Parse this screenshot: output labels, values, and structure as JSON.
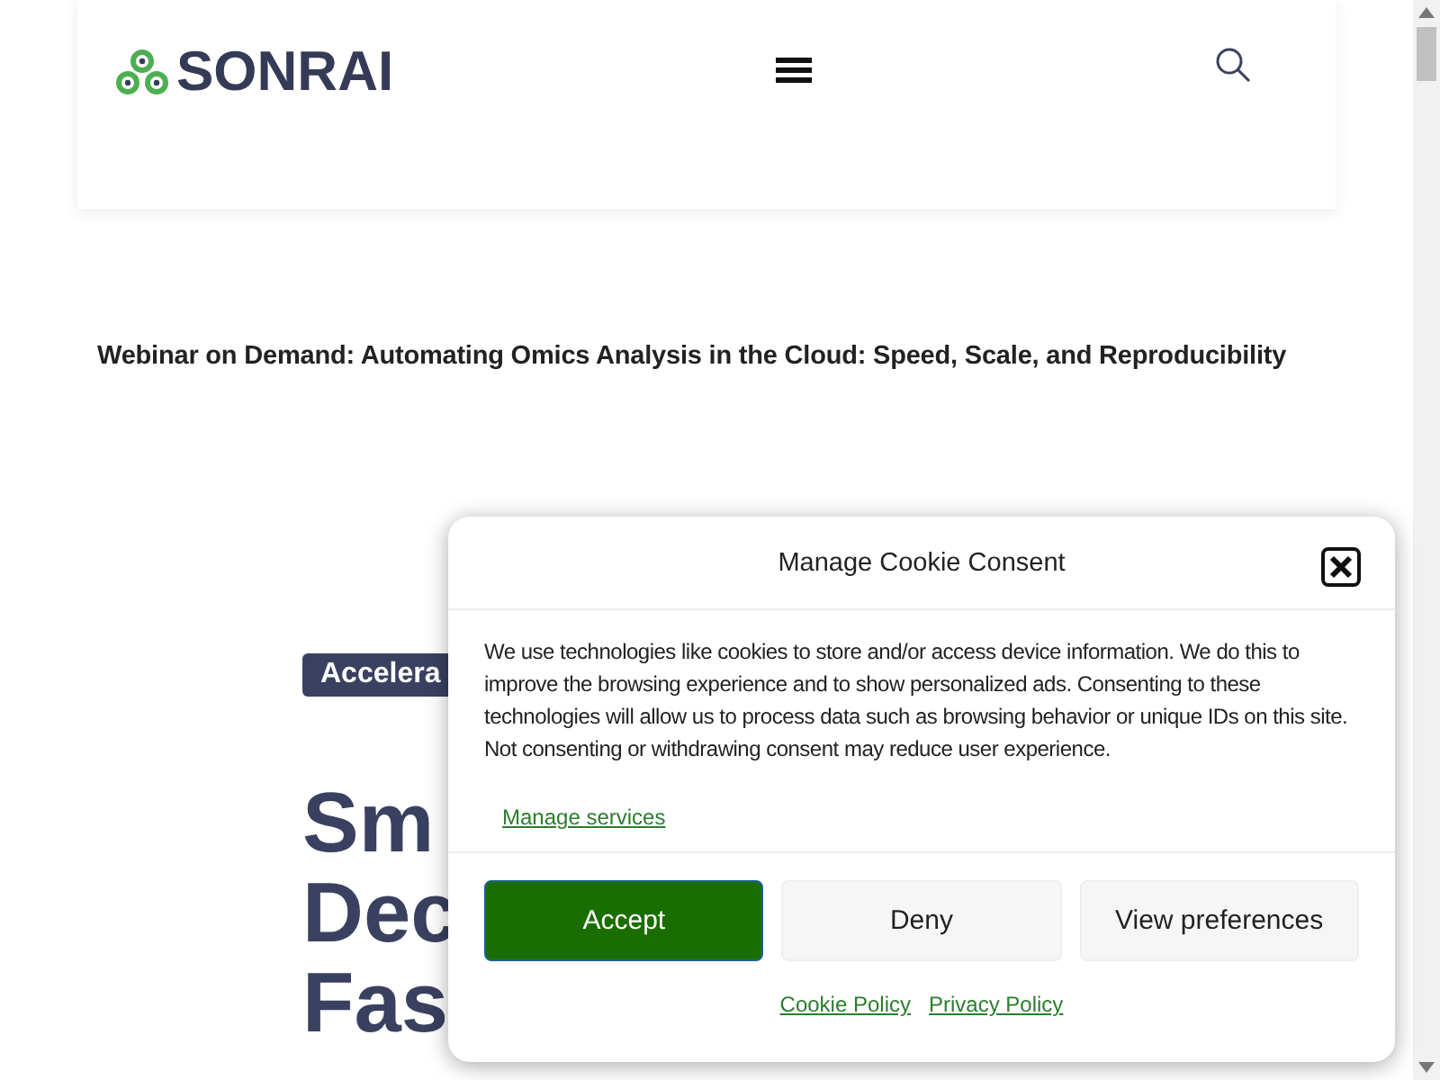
{
  "header": {
    "logo": "SONRAI"
  },
  "page_title": "Webinar on Demand: Automating Omics Analysis in the Cloud: Speed, Scale, and Reproducibility",
  "hero": {
    "badge": "Accelera",
    "heading_lines": [
      "Sm",
      "Dec",
      "Fas"
    ]
  },
  "cookie_dialog": {
    "title": "Manage Cookie Consent",
    "text": "We use technologies like cookies to store and/or access device information. We do this to improve the browsing experience and to show personalized ads. Consenting to these technologies will allow us to process data such as browsing behavior or unique IDs on this site. Not consenting or withdrawing consent may reduce user experience.",
    "manage_link": "Manage services",
    "buttons": [
      {
        "label": "Accept",
        "kind": "primary"
      },
      {
        "label": "Deny",
        "kind": "secondary"
      },
      {
        "label": "View preferences",
        "kind": "secondary"
      }
    ],
    "links": [
      "Cookie Policy",
      "Privacy Policy"
    ]
  }
}
